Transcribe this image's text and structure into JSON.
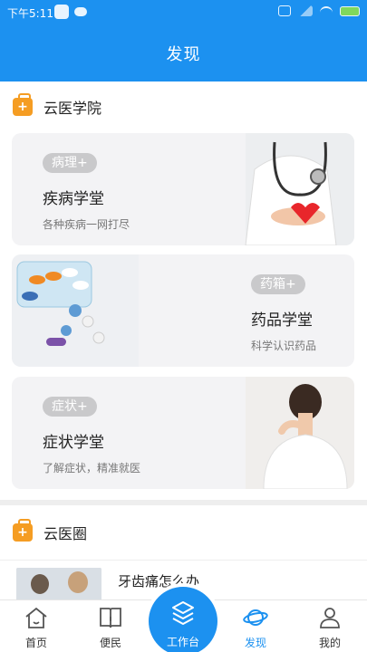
{
  "status": {
    "time": "下午5:11"
  },
  "header": {
    "title": "发现"
  },
  "sections": [
    {
      "title": "云医学院"
    },
    {
      "title": "云医圈"
    }
  ],
  "cards": [
    {
      "tag": "病理+",
      "title": "疾病学堂",
      "subtitle": "各种疾病一网打尽"
    },
    {
      "tag": "药箱+",
      "title": "药品学堂",
      "subtitle": "科学认识药品"
    },
    {
      "tag": "症状+",
      "title": "症状学堂",
      "subtitle": "了解症状，精准就医"
    }
  ],
  "articles": [
    {
      "title": "牙齿痛怎么办"
    }
  ],
  "nav": {
    "items": [
      {
        "label": "首页",
        "icon": "home-icon"
      },
      {
        "label": "便民",
        "icon": "book-icon"
      },
      {
        "label": "工作台",
        "icon": "layers-icon"
      },
      {
        "label": "发现",
        "icon": "planet-icon"
      },
      {
        "label": "我的",
        "icon": "person-icon"
      }
    ],
    "active": "发现",
    "accent": "#1c91f0"
  }
}
